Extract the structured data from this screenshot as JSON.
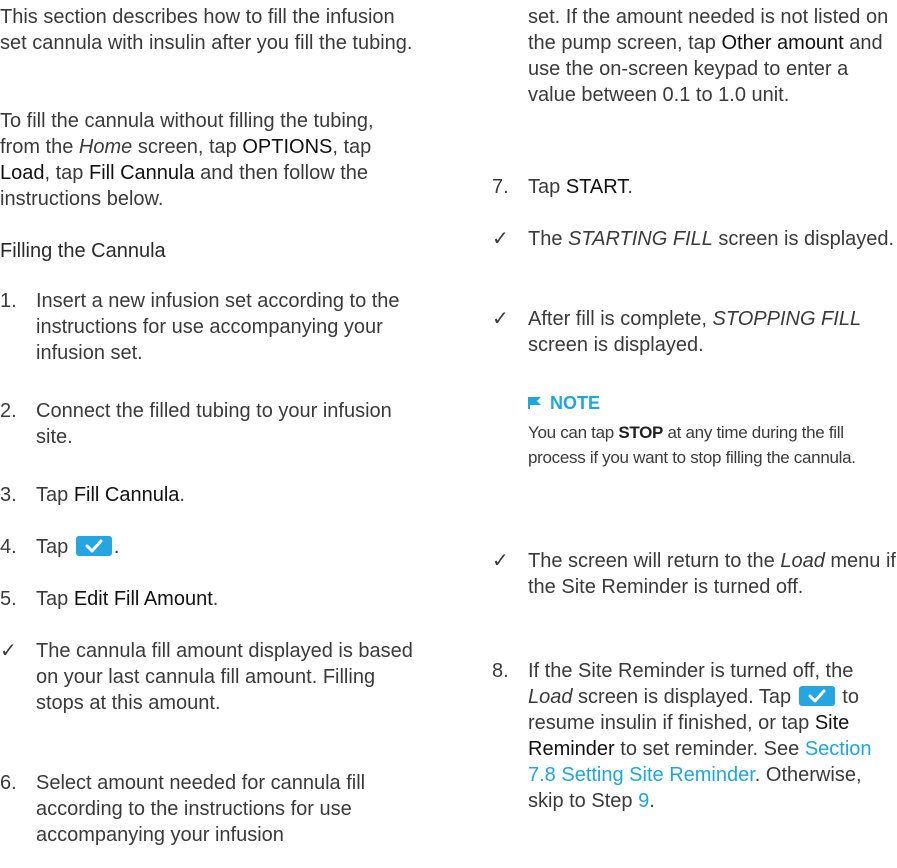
{
  "left": {
    "intro": "This section describes how to fill the infusion set cannula with insulin after you fill the tubing.",
    "para2": {
      "a": "To fill the cannula without filling the tubing, from the ",
      "home": "Home",
      "b": " screen, tap ",
      "options": "OPTIONS",
      "c": ", tap ",
      "load": "Load",
      "d": ", tap ",
      "fill_cannula": "Fill Cannula",
      "e": " and then follow the instructions below."
    },
    "heading": "Filling the Cannula",
    "step1": {
      "num": "1.",
      "text": "Insert a new infusion set according to the instructions for use accompanying your infusion set."
    },
    "step2": {
      "num": "2.",
      "text": "Connect the filled tubing to your infusion site."
    },
    "step3": {
      "num": "3.",
      "a": "Tap ",
      "ui": "Fill Cannula",
      "b": "."
    },
    "step4": {
      "num": "4.",
      "a": "Tap ",
      "b": "."
    },
    "step5": {
      "num": "5.",
      "a": "Tap ",
      "ui": "Edit Fill Amount",
      "b": "."
    },
    "check1": {
      "mark": "✓",
      "text": "The cannula fill amount displayed is based on your last cannula fill amount. Filling stops at this amount."
    },
    "step6": {
      "num": "6.",
      "text": "Select amount needed for cannula fill according to the instructions for use accompanying your infusion"
    }
  },
  "right": {
    "step6_cont": {
      "a": "set. If the amount needed is not listed on the pump screen, tap ",
      "ui": "Other amount",
      "b": " and use the on-screen keypad to enter a value between 0.1 to 1.0 unit."
    },
    "step7": {
      "num": "7.",
      "a": "Tap ",
      "ui": "START",
      "b": "."
    },
    "check2": {
      "mark": "✓",
      "a": "The ",
      "it": "STARTING FILL",
      "b": " screen is displayed."
    },
    "check3": {
      "mark": "✓",
      "a": "After fill is complete, ",
      "it": "STOPPING FILL",
      "b": " screen is displayed."
    },
    "note": {
      "title": "NOTE",
      "a": "You can tap ",
      "stop": "STOP",
      "b": " at any time during the fill process if you want to stop filling the cannula."
    },
    "check4": {
      "mark": "✓",
      "a": "The screen will return to the ",
      "it": "Load",
      "b": " menu if the Site Reminder is turned off."
    },
    "step8": {
      "num": "8.",
      "a": "If the Site Reminder is turned off, the ",
      "it": "Load",
      "b": " screen is displayed. Tap ",
      "c": " to resume insulin if finished, or tap ",
      "ui": "Site Reminder",
      "d": " to set reminder. See ",
      "link": "Section 7.8 Setting Site Reminder",
      "e": ". Otherwise, skip to Step ",
      "link2": "9",
      "f": "."
    }
  },
  "colors": {
    "accent": "#1fa6dc",
    "button": "#26a6e0"
  },
  "icons": {
    "check_button": "checkmark-button-icon",
    "note_flag": "flag-icon"
  }
}
